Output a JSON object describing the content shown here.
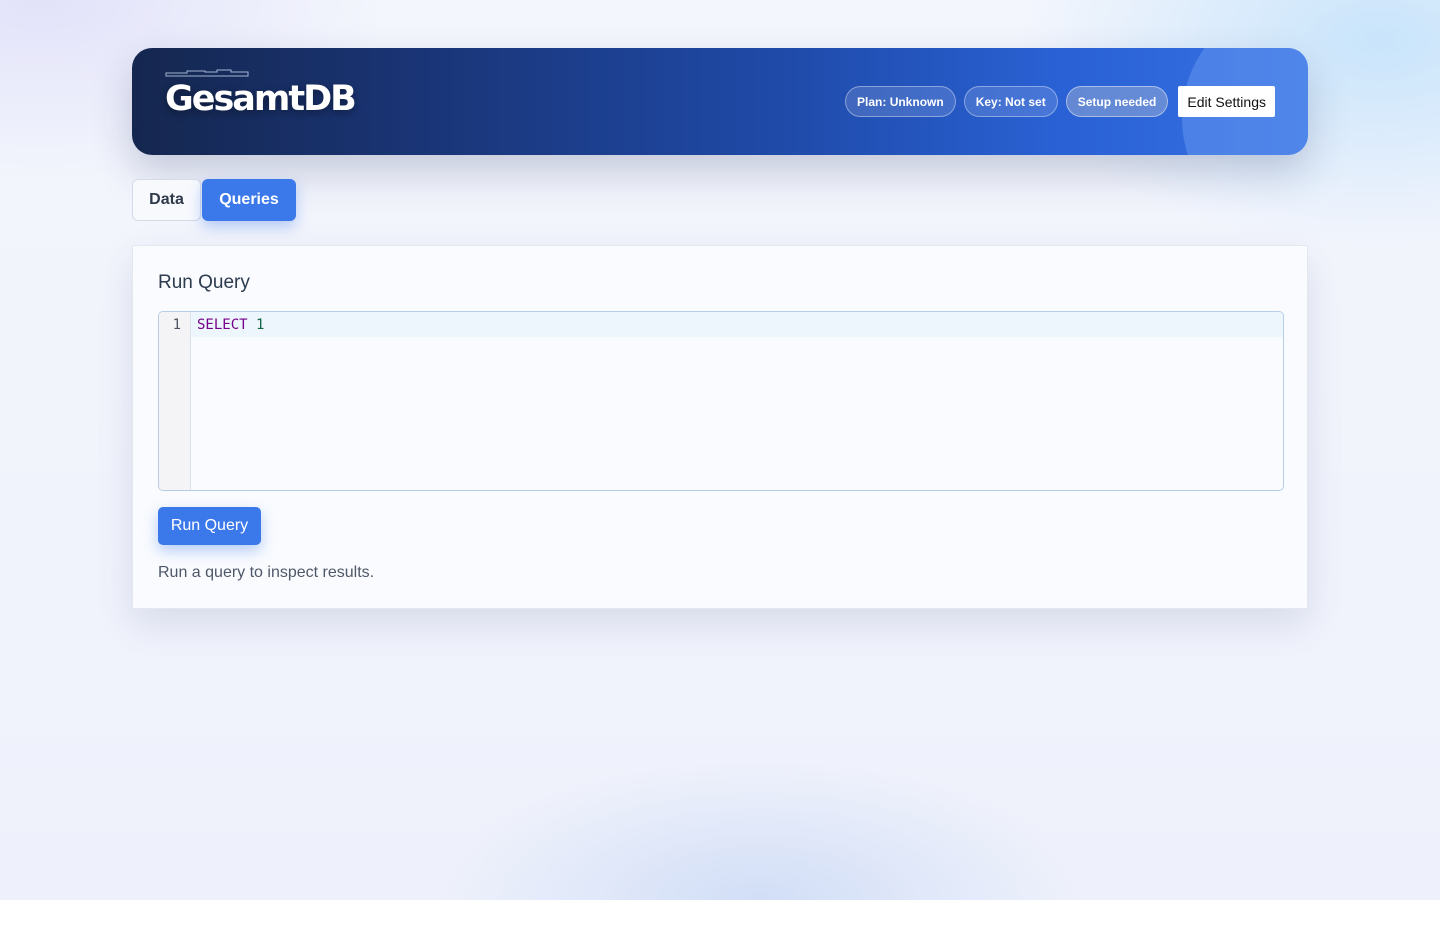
{
  "app": {
    "brand": "GesamtDB"
  },
  "header": {
    "plan_label": "Plan: Unknown",
    "key_label": "Key: Not set",
    "setup_label": "Setup needed",
    "settings_button": "Edit Settings"
  },
  "tabs": [
    {
      "label": "Data",
      "active": false
    },
    {
      "label": "Queries",
      "active": true
    }
  ],
  "query_panel": {
    "title": "Run Query",
    "editor": {
      "line_number": "1",
      "keyword": "SELECT",
      "number": "1"
    },
    "run_button": "Run Query",
    "hint": "Run a query to inspect results."
  },
  "colors": {
    "accent": "#3b78ea",
    "header_dark": "#15274f",
    "header_light": "#3671e2",
    "sql_keyword": "#770088",
    "sql_number": "#116644"
  }
}
